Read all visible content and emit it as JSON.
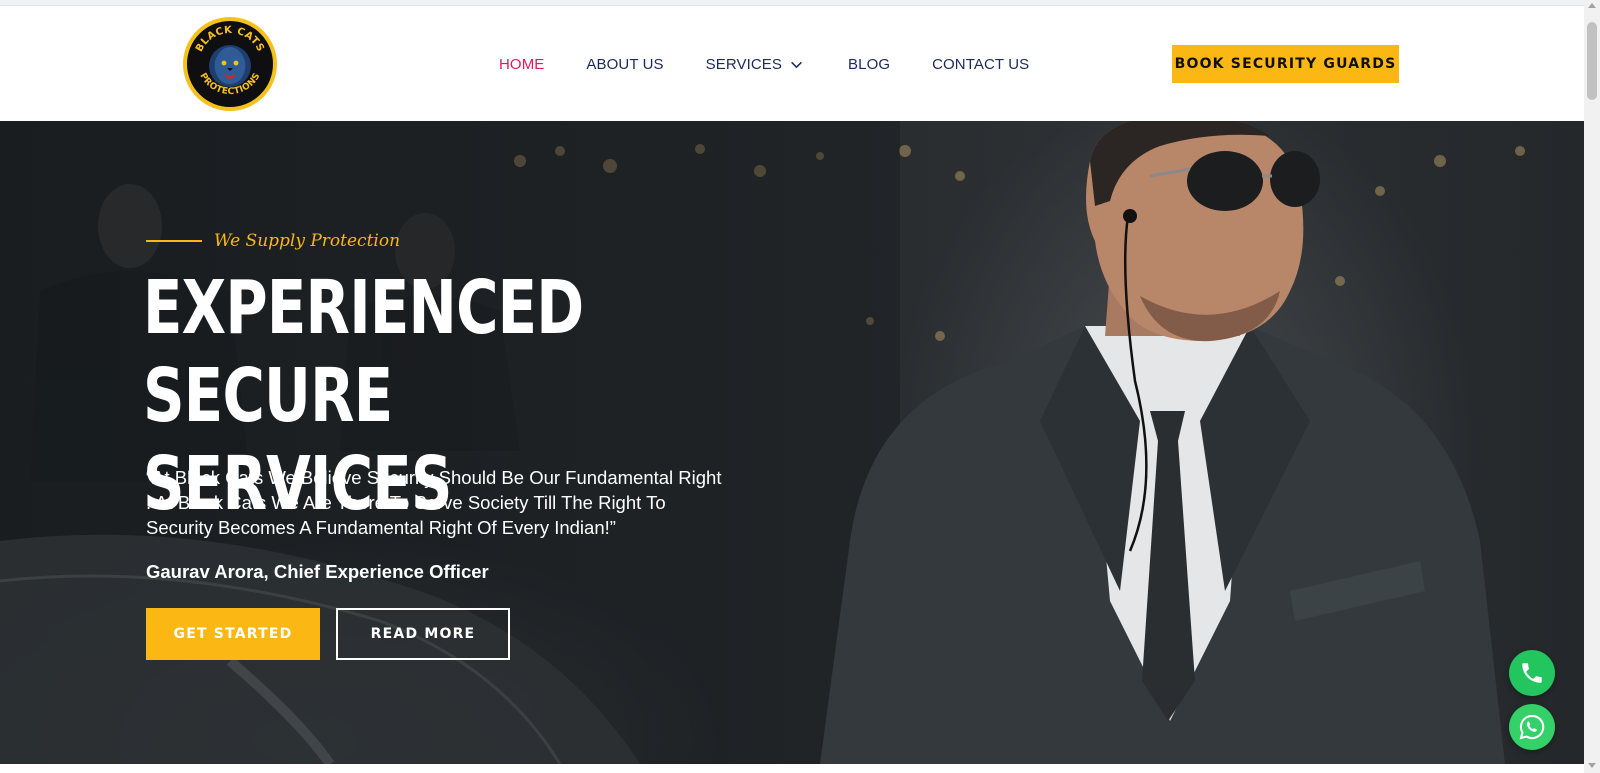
{
  "header": {
    "logo": {
      "icon": "lion-shield-logo",
      "text_top": "BLACK CATS",
      "text_bottom": "PROTECTIONS"
    },
    "nav": [
      {
        "label": "HOME",
        "active": true
      },
      {
        "label": "ABOUT US",
        "active": false
      },
      {
        "label": "SERVICES",
        "active": false,
        "icon": "chevron-down-icon"
      },
      {
        "label": "BLOG",
        "active": false
      },
      {
        "label": "CONTACT US",
        "active": false
      }
    ],
    "cta_label": "BOOK SECURITY GUARDS"
  },
  "hero": {
    "tagline": "We Supply Protection",
    "title_line1": "EXPERIENCED SECURE",
    "title_line2": "SERVICES",
    "quote": "“At Black Cats We Believe Security Should Be Our Fundamental Right . At Black Cats We Are There To Serve Society Till The Right To Security Becomes A Fundamental Right Of Every Indian!”",
    "author": "Gaurav Arora, Chief Experience Officer",
    "primary_button": "GET STARTED",
    "secondary_button": "READ MORE",
    "image": "security-guard-in-suit-photo"
  },
  "floating": {
    "phone_icon": "phone-icon",
    "whatsapp_icon": "whatsapp-icon"
  },
  "colors": {
    "accent": "#fbb814",
    "nav_active": "#e8175d",
    "nav_text": "#1b2a5c",
    "whatsapp_green": "#23c55e"
  }
}
